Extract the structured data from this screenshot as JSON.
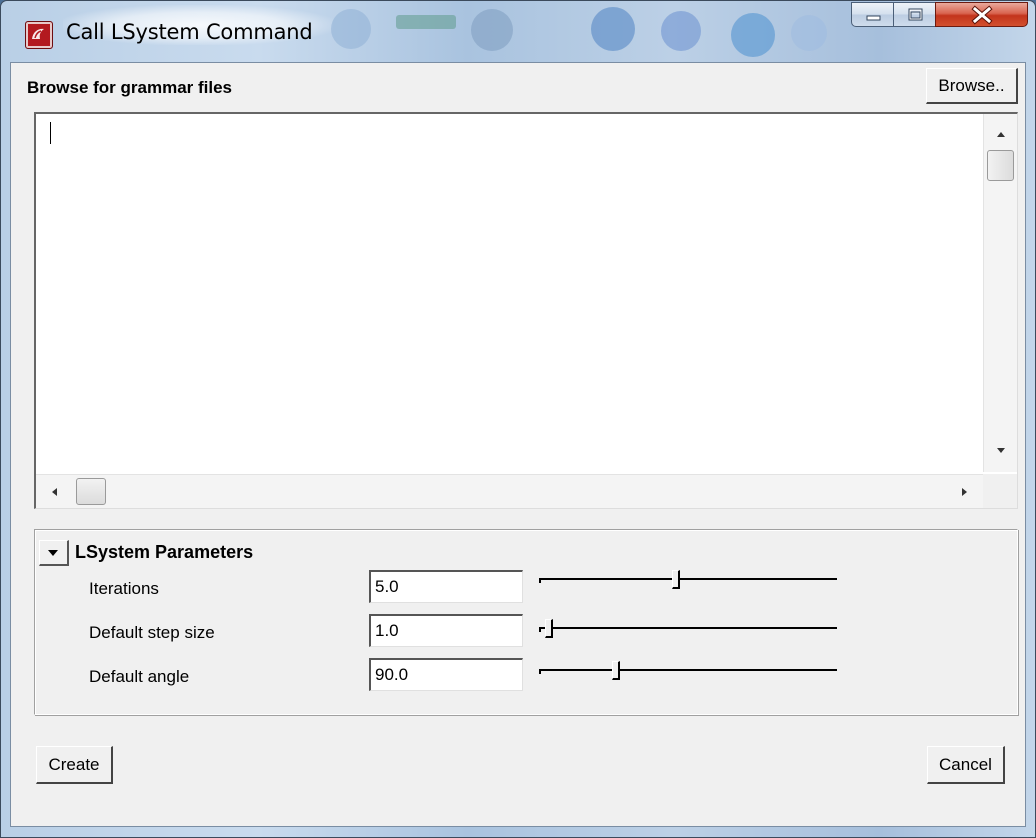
{
  "window": {
    "title": "Call LSystem Command",
    "icon": "maya-app-icon",
    "controls": [
      "minimize-icon",
      "maximize-icon",
      "close-icon"
    ]
  },
  "browse_section": {
    "label": "Browse for grammar files",
    "browse_button": "Browse..",
    "textarea_value": ""
  },
  "parameters": {
    "title": "LSystem Parameters",
    "collapse_icon": "triangle-down-icon",
    "rows": [
      {
        "label": "Iterations",
        "value": "5.0",
        "slider_fraction": 0.46
      },
      {
        "label": "Default step size",
        "value": "1.0",
        "slider_fraction": 0.02
      },
      {
        "label": "Default angle",
        "value": "90.0",
        "slider_fraction": 0.25
      }
    ]
  },
  "buttons": {
    "create": "Create",
    "cancel": "Cancel"
  },
  "colors": {
    "close_button": "#c3341c",
    "dialog_background": "#f0f0f0",
    "app_icon": "#b3191f"
  }
}
